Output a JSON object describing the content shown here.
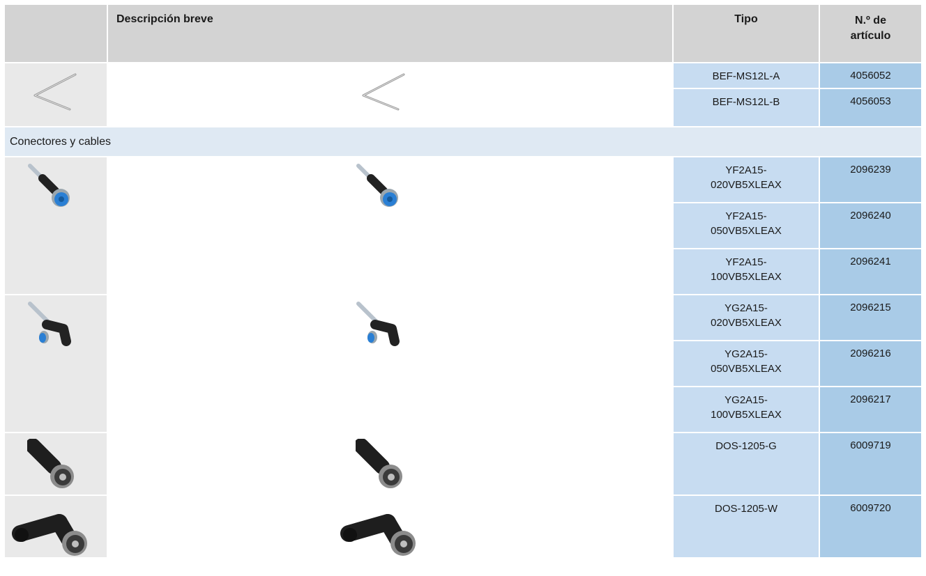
{
  "header": {
    "desc": "Descripción breve",
    "tipo": "Tipo",
    "articulo_line1": "N.º de",
    "articulo_line2": "artículo"
  },
  "section_connectors": "Conectores y cables",
  "rows": [
    {
      "tipo": "BEF-MS12L-A",
      "articulo": "4056052"
    },
    {
      "tipo": "BEF-MS12L-B",
      "articulo": "4056053"
    },
    {
      "tipo_l1": "YF2A15-",
      "tipo_l2": "020VB5XLEAX",
      "articulo": "2096239"
    },
    {
      "tipo_l1": "YF2A15-",
      "tipo_l2": "050VB5XLEAX",
      "articulo": "2096240"
    },
    {
      "tipo_l1": "YF2A15-",
      "tipo_l2": "100VB5XLEAX",
      "articulo": "2096241"
    },
    {
      "tipo_l1": "YG2A15-",
      "tipo_l2": "020VB5XLEAX",
      "articulo": "2096215"
    },
    {
      "tipo_l1": "YG2A15-",
      "tipo_l2": "050VB5XLEAX",
      "articulo": "2096216"
    },
    {
      "tipo_l1": "YG2A15-",
      "tipo_l2": "100VB5XLEAX",
      "articulo": "2096217"
    },
    {
      "tipo": "DOS-1205-G",
      "articulo": "6009719"
    },
    {
      "tipo": "DOS-1205-W",
      "articulo": "6009720"
    }
  ],
  "icons": [
    "hex-key-icon",
    "straight-cable-connector-icon",
    "angled-cable-connector-icon",
    "straight-field-connector-icon",
    "angled-field-connector-icon"
  ],
  "colors": {
    "header_gray": "#d3d3d3",
    "image_col": "#e9e9e9",
    "tipo_col": "#c7dcf1",
    "articulo_col": "#a9cbe7",
    "section_band": "#dfe9f3"
  }
}
